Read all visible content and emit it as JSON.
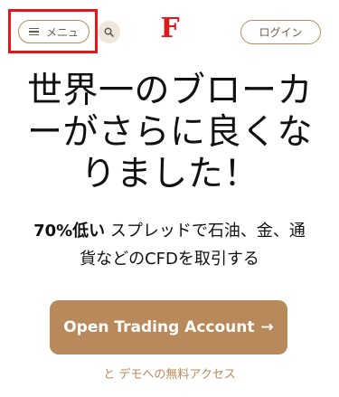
{
  "header": {
    "menu_label": "メニュ",
    "logo_text": "F",
    "login_label": "ログイン"
  },
  "hero": {
    "headline_line1": "世界一のブローカ",
    "headline_line2": "ーがさらに良くな",
    "headline_line3": "りました！",
    "subtext_bold": "70%低い",
    "subtext_rest1": " スプレッドで石油、金、通",
    "subtext_line2": "貨などのCFDを取引する",
    "cta_label": "Open Trading Account",
    "cta_arrow": "→",
    "demo_link": "と デモへの無料アクセス"
  },
  "colors": {
    "accent": "#b8895a",
    "logo": "#e3161c",
    "highlight": "#e3161c"
  },
  "icons": {
    "menu": "hamburger-icon",
    "search": "search-icon",
    "arrow": "arrow-right-icon"
  }
}
